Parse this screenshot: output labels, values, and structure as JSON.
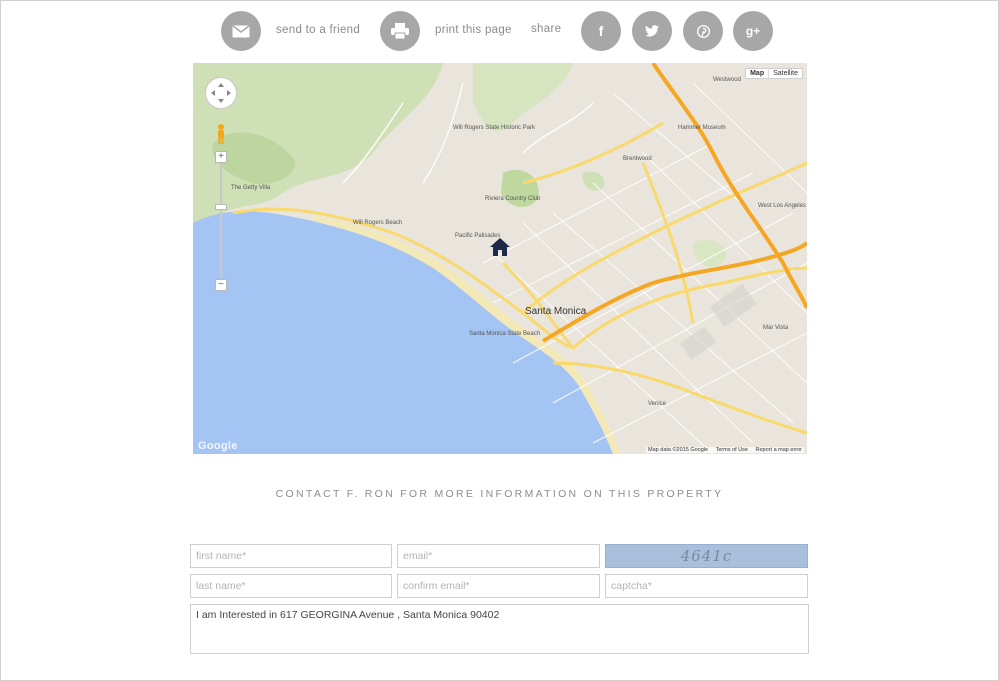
{
  "actions": {
    "send_label": "send to a friend",
    "print_label": "print this page",
    "share_label": "share",
    "social_icons": [
      "facebook-icon",
      "twitter-icon",
      "pinterest-icon",
      "google-plus-icon"
    ],
    "social_glyphs": [
      "f",
      "",
      "",
      "g+"
    ]
  },
  "map": {
    "toggle": {
      "map_label": "Map",
      "satellite_label": "Satellite"
    },
    "city_label": "Santa Monica",
    "places": [
      "Will Rogers State Historic Park",
      "The Getty Villa",
      "Will Rogers Beach",
      "Riviera Country Club",
      "Pacific Palisades",
      "Santa Monica State Beach",
      "Brentwood",
      "Westwood",
      "Hammer Museum",
      "West Los Angeles",
      "Mar Vista",
      "Venice"
    ],
    "google_logo": "Google",
    "attribution": {
      "data": "Map data ©2015 Google",
      "terms": "Terms of Use",
      "report": "Report a map error"
    },
    "zoom_in": "+",
    "zoom_out": "−"
  },
  "contact": {
    "heading": "CONTACT F. RON FOR MORE INFORMATION ON THIS PROPERTY"
  },
  "form": {
    "first_name_placeholder": "first name*",
    "last_name_placeholder": "last name*",
    "email_placeholder": "email*",
    "confirm_email_placeholder": "confirm email*",
    "captcha_placeholder": "captcha*",
    "captcha_text": "4641c",
    "message_value": "I am Interested in 617 GEORGINA Avenue , Santa Monica 90402"
  },
  "colors": {
    "icon_circle": "#a7a7a7",
    "captcha_bg": "#a9c0dc",
    "water": "#a4c4f4",
    "highway": "#f5a623"
  }
}
